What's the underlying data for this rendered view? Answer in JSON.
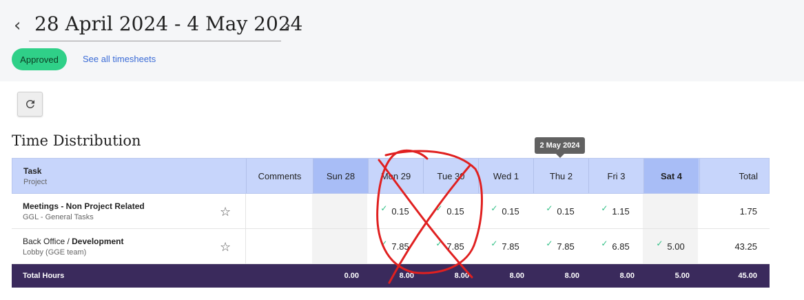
{
  "header": {
    "prev_arrow": "‹",
    "next_arrow": "›",
    "date_range": "28 April 2024 - 4 May 2024",
    "status_badge": "Approved",
    "see_all_link": "See all timesheets"
  },
  "section_title": "Time Distribution",
  "tooltip": "2 May 2024",
  "table": {
    "header": {
      "task": "Task",
      "project": "Project",
      "comments": "Comments",
      "days": [
        "Sun 28",
        "Mon 29",
        "Tue 30",
        "Wed 1",
        "Thu 2",
        "Fri 3",
        "Sat 4"
      ],
      "total": "Total"
    },
    "rows": [
      {
        "task_title": "Meetings - Non Project Related",
        "project": "GGL - General Tasks",
        "days": [
          "",
          "0.15",
          "0.15",
          "0.15",
          "0.15",
          "1.15",
          ""
        ],
        "total": "1.75"
      },
      {
        "task_prefix": "Back Office / ",
        "task_title": "Development",
        "project": "Lobby (GGE team)",
        "days": [
          "",
          "7.85",
          "7.85",
          "7.85",
          "7.85",
          "6.85",
          "5.00"
        ],
        "total": "43.25"
      }
    ],
    "totals": {
      "label": "Total Hours",
      "days": [
        "0.00",
        "8.00",
        "8.00",
        "8.00",
        "8.00",
        "8.00",
        "5.00"
      ],
      "total": "45.00"
    }
  },
  "icons": {
    "refresh": "refresh-icon",
    "star": "star-outline-icon",
    "check": "check-icon"
  },
  "colors": {
    "badge": "#2fd088",
    "header_bg": "#c7d5fb",
    "weekend_header": "#a8bdf6",
    "totals_bg": "#3a2a5c",
    "link": "#3a6bd6",
    "annotation": "#e02020"
  }
}
